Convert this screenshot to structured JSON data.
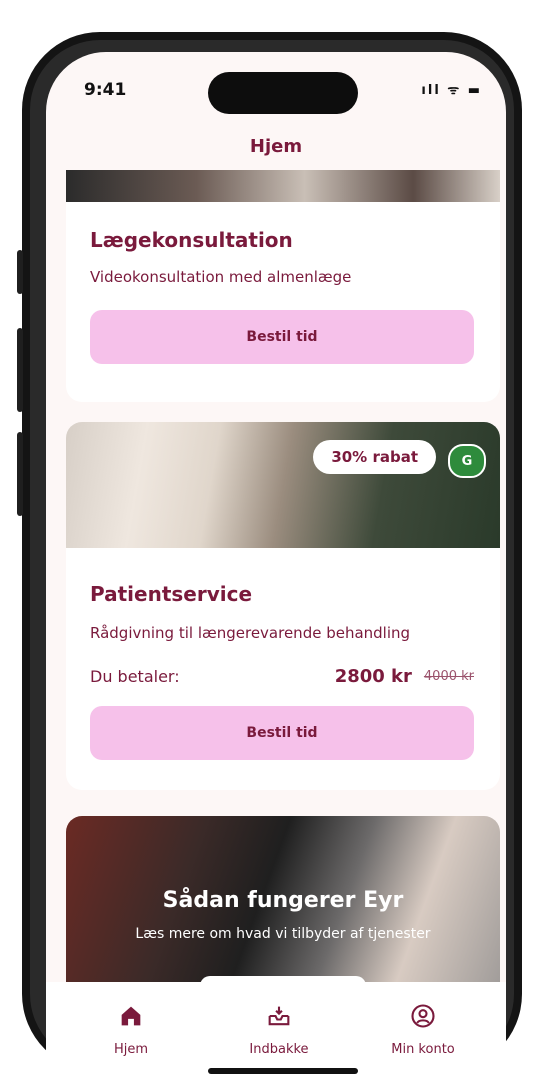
{
  "status": {
    "time": "9:41",
    "icons": "ıll ᯤ ▬"
  },
  "header": {
    "title": "Hjem"
  },
  "cards": [
    {
      "title": "Lægekonsultation",
      "subtitle": "Videokonsultation med almenlæge",
      "button_label": "Bestil tid"
    },
    {
      "title": "Patientservice",
      "subtitle": "Rådgivning til længerevarende behandling",
      "discount_label": "30% rabat",
      "badge": "G",
      "price_label": "Du betaler:",
      "price_now": "2800 kr",
      "price_old": "4000 kr",
      "button_label": "Bestil tid"
    }
  ],
  "promo": {
    "title": "Sådan fungerer Eyr",
    "subtitle": "Læs mere om hvad vi tilbyder af tjenester"
  },
  "tabbar": {
    "items": [
      {
        "label": "Hjem",
        "icon": "home-icon",
        "active": true
      },
      {
        "label": "Indbakke",
        "icon": "inbox-icon",
        "active": false
      },
      {
        "label": "Min konto",
        "icon": "account-icon",
        "active": false
      }
    ]
  },
  "colors": {
    "brand": "#7a1a3c",
    "button": "#f6c1ea",
    "background": "#fdf7f6",
    "badge_green": "#2e8b3c"
  }
}
